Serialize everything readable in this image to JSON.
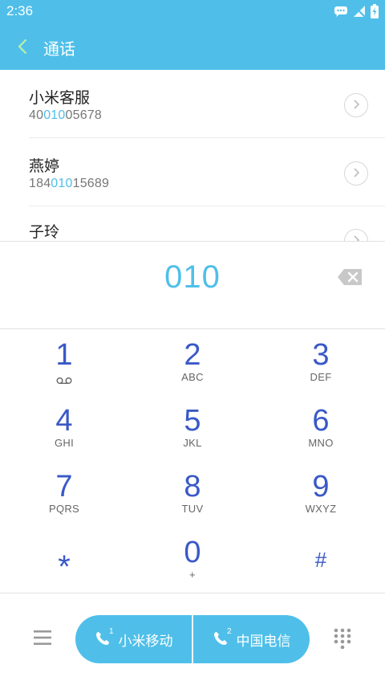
{
  "status_bar": {
    "time": "2:36"
  },
  "header": {
    "title": "通话"
  },
  "contacts": [
    {
      "name": "小米客服",
      "number_pre": "40",
      "number_hl": "010",
      "number_post": "05678"
    },
    {
      "name": "燕婷",
      "number_pre": "184",
      "number_hl": "010",
      "number_post": "15689"
    },
    {
      "name": "子玲",
      "number_pre": "",
      "number_hl": "",
      "number_post": ""
    }
  ],
  "dialer": {
    "digits": "010"
  },
  "keys": [
    {
      "digit": "1",
      "letters": ""
    },
    {
      "digit": "2",
      "letters": "ABC"
    },
    {
      "digit": "3",
      "letters": "DEF"
    },
    {
      "digit": "4",
      "letters": "GHI"
    },
    {
      "digit": "5",
      "letters": "JKL"
    },
    {
      "digit": "6",
      "letters": "MNO"
    },
    {
      "digit": "7",
      "letters": "PQRS"
    },
    {
      "digit": "8",
      "letters": "TUV"
    },
    {
      "digit": "9",
      "letters": "WXYZ"
    },
    {
      "digit": "*",
      "letters": ""
    },
    {
      "digit": "0",
      "letters": "+"
    },
    {
      "digit": "#",
      "letters": ""
    }
  ],
  "call_buttons": {
    "sim1": {
      "label": "小米移动",
      "index": "1"
    },
    "sim2": {
      "label": "中国电信",
      "index": "2"
    }
  },
  "colors": {
    "accent": "#4fbfe9",
    "key_digit": "#3a59c7"
  }
}
